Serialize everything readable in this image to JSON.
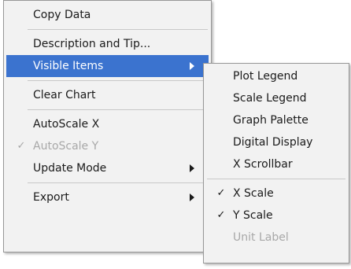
{
  "main_menu": {
    "copy_data": "Copy Data",
    "description_tip": "Description and Tip...",
    "visible_items": "Visible Items",
    "clear_chart": "Clear Chart",
    "autoscale_x": "AutoScale X",
    "autoscale_y": "AutoScale Y",
    "update_mode": "Update Mode",
    "export": "Export"
  },
  "sub_menu": {
    "plot_legend": "Plot Legend",
    "scale_legend": "Scale Legend",
    "graph_palette": "Graph Palette",
    "digital_display": "Digital Display",
    "x_scrollbar": "X Scrollbar",
    "x_scale": "X Scale",
    "y_scale": "Y Scale",
    "unit_label": "Unit Label"
  },
  "check_glyph": "✓",
  "colors": {
    "highlight": "#3b73cf",
    "menu_bg": "#f2f2f2",
    "disabled_text": "#a8a8a8"
  }
}
